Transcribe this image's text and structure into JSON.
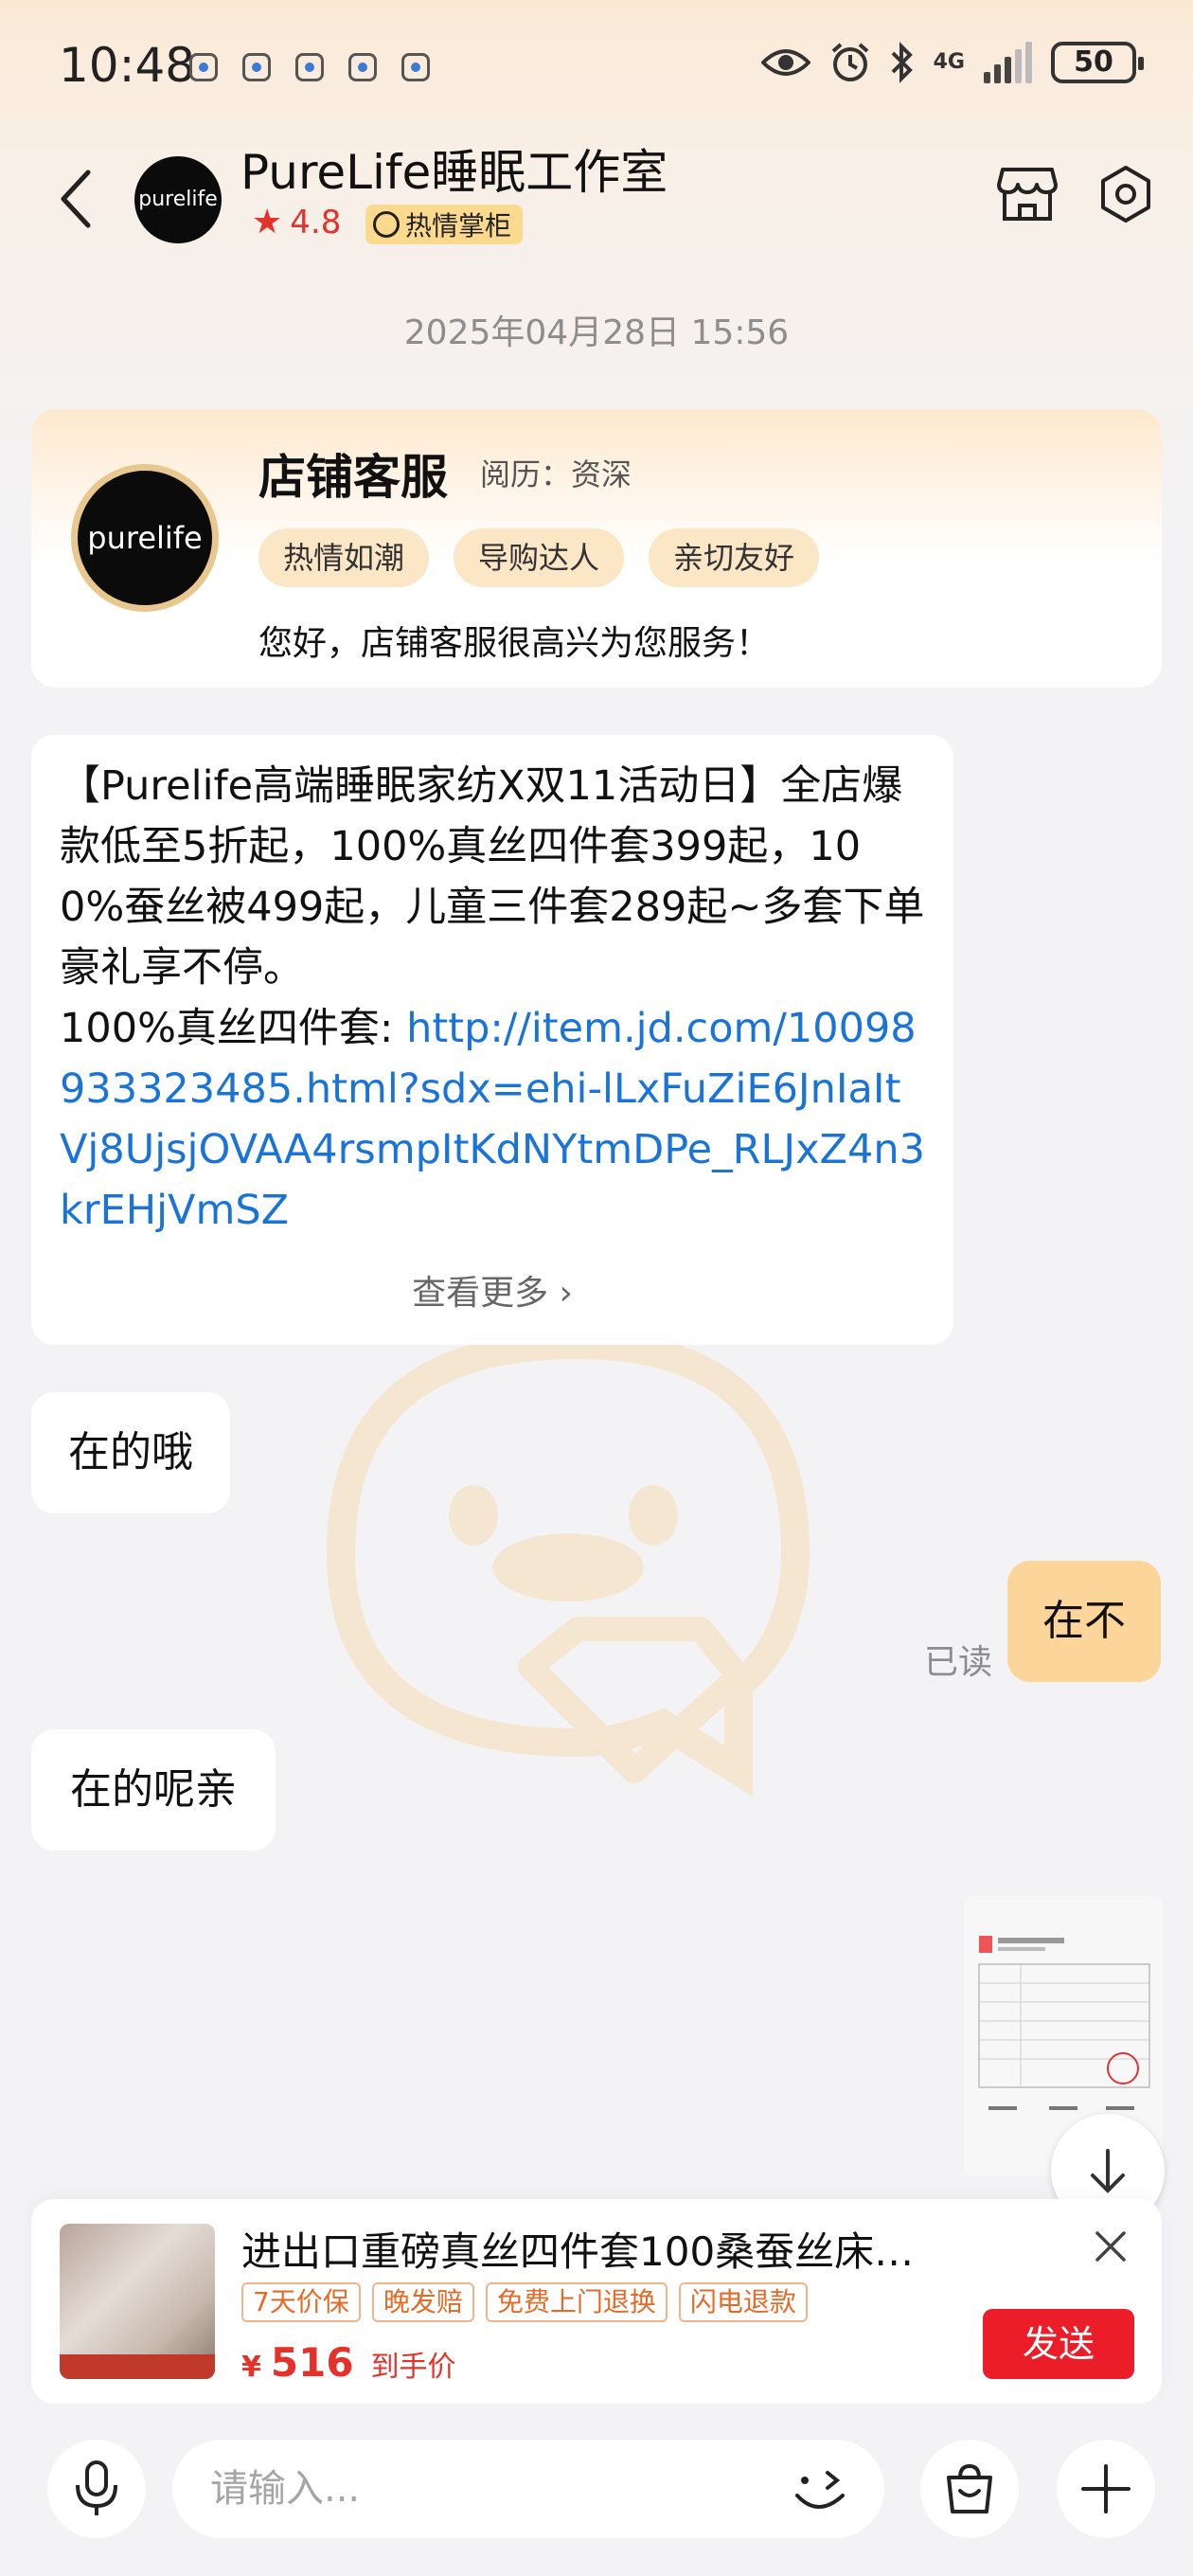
{
  "status_bar": {
    "time": "10:48",
    "network": "4G",
    "battery": "50",
    "notification_icons": [
      "app-notification-icon",
      "app-notification-icon",
      "app-notification-icon",
      "app-notification-icon",
      "app-notification-icon"
    ]
  },
  "header": {
    "shop_name": "PureLife睡眠工作室",
    "avatar_text": "purelife",
    "rating": "4.8",
    "badge": "热情掌柜"
  },
  "timestamp": "2025年04月28日 15:56",
  "service_card": {
    "avatar_text": "purelife",
    "title": "店铺客服",
    "experience": "阅历：资深",
    "tags": [
      "热情如潮",
      "导购达人",
      "亲切友好"
    ],
    "greeting": "您好，店铺客服很高兴为您服务！"
  },
  "messages": {
    "promo_text": "【Purelife高端睡眠家纺X双11活动日】全店爆款低至5折起，100%真丝四件套399起，100%蚕丝被499起，儿童三件套289起~多套下单豪礼享不停。",
    "promo_link_label": "100%真丝四件套: ",
    "promo_link": "http://item.jd.com/10098933323485.html?sdx=ehi-lLxFuZiE6JnIaItVj8UjsjOVAA4rsmpItKdNYtmDPe_RLJxZ4n3krEHjVmSZ",
    "see_more": "查看更多 ›",
    "reply1": "在的哦",
    "user_msg": "在不",
    "read_status": "已读",
    "reply2": "在的呢亲"
  },
  "product": {
    "title": "进出口重磅真丝四件套100桑蚕丝床…",
    "tags": [
      "7天价保",
      "晚发赔",
      "免费上门退换",
      "闪电退款"
    ],
    "currency": "¥",
    "price": "516",
    "price_label": "到手价",
    "send_label": "发送"
  },
  "input": {
    "placeholder": "请输入..."
  },
  "colors": {
    "accent_red": "#ea1d28",
    "user_bubble": "#fcd59b",
    "link_blue": "#1a74d8"
  }
}
